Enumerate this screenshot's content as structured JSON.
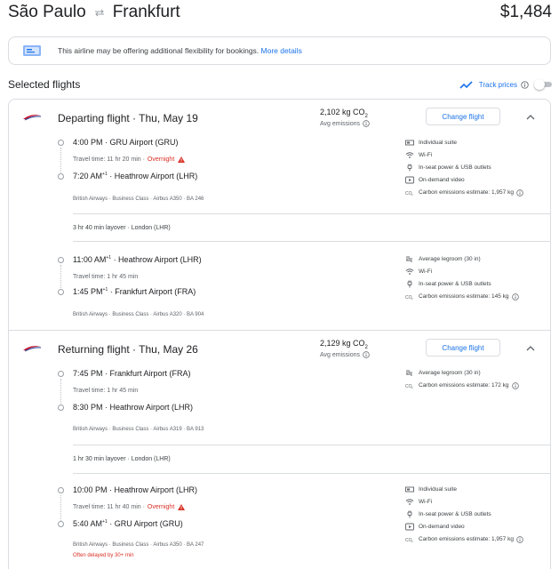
{
  "header": {
    "origin": "São Paulo",
    "destination": "Frankfurt",
    "price": "$1,484"
  },
  "notice": {
    "text": "This airline may be offering additional flexibility for bookings. ",
    "link": "More details"
  },
  "selected": {
    "title": "Selected flights",
    "track_label": "Track prices"
  },
  "departing": {
    "title": "Departing flight · Thu, May 19",
    "emissions": "2,102 kg CO",
    "emissions_sub": "2",
    "emissions_note": "Avg emissions",
    "change_label": "Change flight",
    "seg1": {
      "dep_time": "4:00 PM",
      "dep_airport": " · GRU Airport (GRU)",
      "travel": "Travel time: 11 hr 20 min · ",
      "overnight": "Overnight",
      "arr_time": "7:20 AM",
      "arr_plus": "+1",
      "arr_airport": " · Heathrow Airport (LHR)",
      "meta": "British Airways · Business Class · Airbus A350 · BA 246",
      "amenities": [
        {
          "icon": "suite-icon",
          "label": "Individual suite"
        },
        {
          "icon": "wifi-icon",
          "label": "Wi-Fi"
        },
        {
          "icon": "power-icon",
          "label": "In-seat power & USB outlets"
        },
        {
          "icon": "video-icon",
          "label": "On-demand video"
        },
        {
          "icon": "co2-icon",
          "label": "Carbon emissions estimate: 1,957 kg"
        }
      ]
    },
    "layover": "3 hr 40 min layover · London (LHR)",
    "seg2": {
      "dep_time": "11:00 AM",
      "dep_plus": "+1",
      "dep_airport": " · Heathrow Airport (LHR)",
      "travel": "Travel time: 1 hr 45 min",
      "arr_time": "1:45 PM",
      "arr_plus": "+1",
      "arr_airport": " · Frankfurt Airport (FRA)",
      "meta": "British Airways · Business Class · Airbus A320 · BA 904",
      "amenities": [
        {
          "icon": "legroom-icon",
          "label": "Average legroom (30 in)"
        },
        {
          "icon": "wifi-icon",
          "label": "Wi-Fi"
        },
        {
          "icon": "power-icon",
          "label": "In-seat power & USB outlets"
        },
        {
          "icon": "co2-icon",
          "label": "Carbon emissions estimate: 145 kg"
        }
      ]
    }
  },
  "returning": {
    "title": "Returning flight · Thu, May 26",
    "emissions": "2,129 kg CO",
    "emissions_sub": "2",
    "emissions_note": "Avg emissions",
    "change_label": "Change flight",
    "seg1": {
      "dep_time": "7:45 PM",
      "dep_airport": " · Frankfurt Airport (FRA)",
      "travel": "Travel time: 1 hr 45 min",
      "arr_time": "8:30 PM",
      "arr_airport": " · Heathrow Airport (LHR)",
      "meta": "British Airways · Business Class · Airbus A319 · BA 913",
      "amenities": [
        {
          "icon": "legroom-icon",
          "label": "Average legroom (30 in)"
        },
        {
          "icon": "co2-icon",
          "label": "Carbon emissions estimate: 172 kg"
        }
      ]
    },
    "layover": "1 hr 30 min layover · London (LHR)",
    "seg2": {
      "dep_time": "10:00 PM",
      "dep_airport": " · Heathrow Airport (LHR)",
      "travel": "Travel time: 11 hr 40 min · ",
      "overnight": "Overnight",
      "arr_time": "5:40 AM",
      "arr_plus": "+1",
      "arr_airport": " · GRU Airport (GRU)",
      "meta": "British Airways · Business Class · Airbus A350 · BA 247",
      "delay": "Often delayed by 30+ min",
      "amenities": [
        {
          "icon": "suite-icon",
          "label": "Individual suite"
        },
        {
          "icon": "wifi-icon",
          "label": "Wi-Fi"
        },
        {
          "icon": "power-icon",
          "label": "In-seat power & USB outlets"
        },
        {
          "icon": "video-icon",
          "label": "On-demand video"
        },
        {
          "icon": "co2-icon",
          "label": "Carbon emissions estimate: 1,957 kg"
        }
      ]
    }
  },
  "colors": {
    "accent": "#1a73e8",
    "warning": "#d93025",
    "airline": "#c8102e"
  }
}
